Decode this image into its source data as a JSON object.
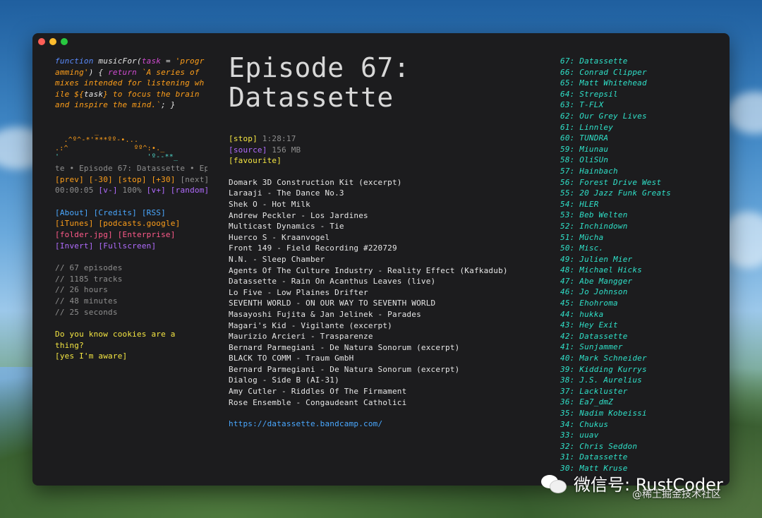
{
  "window": {
    "title_buttons": [
      "close",
      "minimize",
      "maximize"
    ]
  },
  "left": {
    "code": {
      "fn_keyword": "function",
      "fn_name": "musicFor(",
      "param": "task",
      "param_default_prefix": " = ",
      "param_default": "'programming'",
      "after_param": ") { ",
      "return_kw": "return",
      "template_str": " `A series of mixes intended for listening while ${",
      "template_var": "task",
      "template_end": "} to focus the brain and inspire the mind.`",
      "end": "; }"
    },
    "ascii_art": {
      "line1": "         _",
      "line2": "  .^º^-*'***ºº-•...",
      "line3": ".:^               ºº^:•._",
      "line4": "'                    'º--**_"
    },
    "marquee": "te • Episode 67: Datassette • Ep",
    "controls": {
      "prev": "[prev]",
      "back30": "[-30]",
      "stop": "[stop]",
      "fwd30": "[+30]",
      "next": "[next]",
      "time": "00:00:05",
      "vol_down": "[v-]",
      "volume": "100%",
      "vol_up": "[v+]",
      "random": "[random]"
    },
    "links": {
      "about": "[About]",
      "credits": "[Credits]",
      "rss": "[RSS]",
      "itunes": "[iTunes]",
      "google": "[podcasts.google]",
      "folder": "[folder.jpg]",
      "enterprise": "[Enterprise]",
      "invert": "[Invert]",
      "fullscreen": "[Fullscreen]"
    },
    "stats": [
      "// 67 episodes",
      "// 1185 tracks",
      "// 26 hours",
      "// 48 minutes",
      "// 25 seconds"
    ],
    "cookie": {
      "question": "Do you know cookies are a thing?",
      "answer": "[yes I'm aware]"
    }
  },
  "episode": {
    "title_line1": "Episode 67:",
    "title_line2": "Datassette",
    "stop_label": "[stop]",
    "duration": "1:28:17",
    "source_label": "[source]",
    "size": "156 MB",
    "favourite_label": "[favourite]",
    "tracks": [
      "Domark 3D Construction Kit (excerpt)",
      "Laraaji - The Dance No.3",
      "Shek O - Hot Milk",
      "Andrew Peckler - Los Jardines",
      "Multicast Dynamics - Tie",
      "Huerco S - Kraanvogel",
      "Front 149 - Field Recording #220729",
      "N.N. - Sleep Chamber",
      "Agents Of The Culture Industry - Reality Effect (Kafkadub)",
      "Datassette - Rain On Acanthus Leaves (live)",
      "Lo Five - Low Plaines Drifter",
      "SEVENTH WORLD - ON OUR WAY TO SEVENTH WORLD",
      "Masayoshi Fujita & Jan Jelinek - Parades",
      "Magari's Kid - Vigilante (excerpt)",
      "Maurizio Arcieri - Trasparenze",
      "Bernard Parmegiani - De Natura Sonorum (excerpt)",
      "BLACK TO COMM - Traum GmbH",
      "Bernard Parmegiani - De Natura Sonorum (excerpt)",
      "Dialog - Side B (AI-31)",
      "Amy Cutler - Riddles Of The Firmament",
      "Rose Ensemble - Congaudeant Catholici"
    ],
    "link": "https://datassette.bandcamp.com/"
  },
  "episodes_list": [
    "67: Datassette",
    "66: Conrad Clipper",
    "65: Matt Whitehead",
    "64: Strepsil",
    "63: T-FLX",
    "62: Our Grey Lives",
    "61: Linnley",
    "60: TUNDRA",
    "59: Miunau",
    "58: OliSUn",
    "57: Hainbach",
    "56: Forest Drive West",
    "55: 20 Jazz Funk Greats",
    "54: HLER",
    "53: Beb Welten",
    "52: Inchindown",
    "51: Mücha",
    "50: Misc.",
    "49: Julien Mier",
    "48: Michael Hicks",
    "47: Abe Mangger",
    "46: Jo Johnson",
    "45: Ehohroma",
    "44: hukka",
    "43: Hey Exit",
    "42: Datassette",
    "41: Sunjammer",
    "40: Mark Schneider",
    "39: Kidding Kurrys",
    "38: J.S. Aurelius",
    "37: Lackluster",
    "36: Ea7_dmZ",
    "35: Nadim Kobeissi",
    "34: Chukus",
    "33: uuav",
    "32: Chris Seddon",
    "31: Datassette",
    "30: Matt Kruse"
  ],
  "watermark": {
    "text": "微信号: RustCoder",
    "sub": "@稀土掘金技术社区"
  }
}
